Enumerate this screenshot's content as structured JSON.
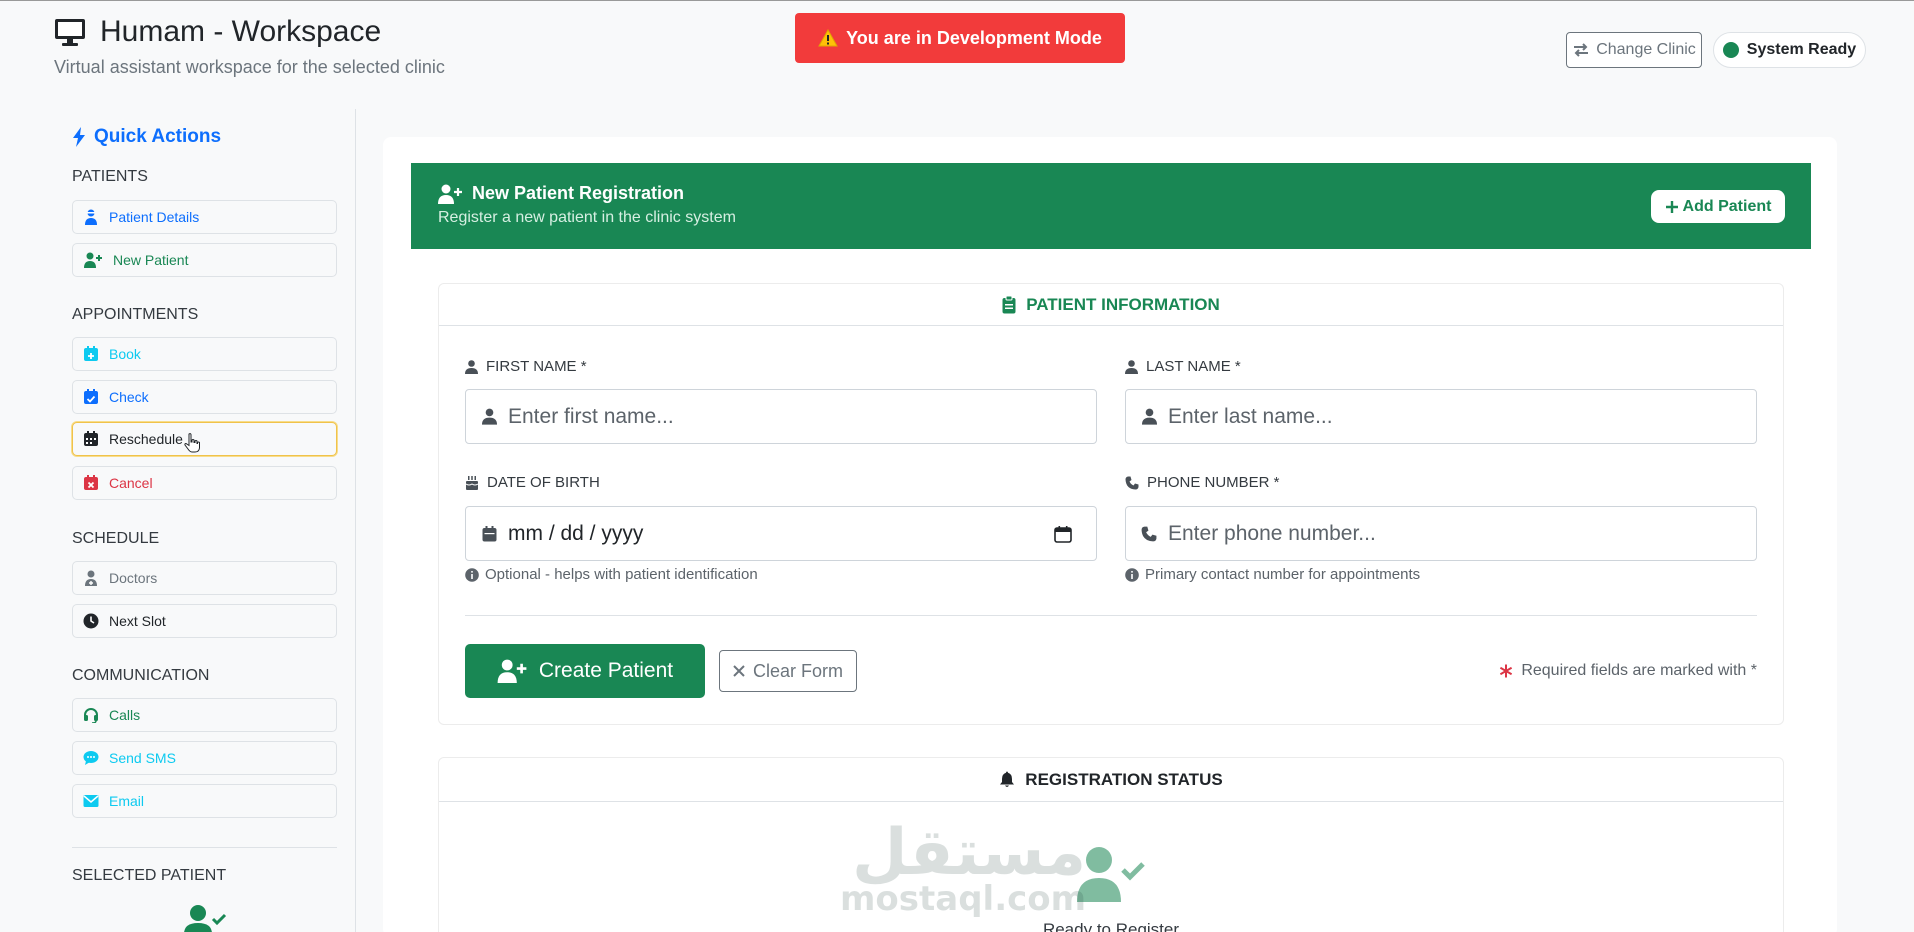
{
  "header": {
    "title": "Humam - Workspace",
    "subtitle": "Virtual assistant workspace for the selected clinic",
    "dev_banner": "You are in Development Mode",
    "change_clinic_label": "Change Clinic",
    "system_status": "System Ready"
  },
  "sidebar": {
    "title": "Quick Actions",
    "sections": {
      "patients": "PATIENTS",
      "appointments": "APPOINTMENTS",
      "schedule": "SCHEDULE",
      "communication": "COMMUNICATION",
      "selected_patient": "SELECTED PATIENT"
    },
    "items": {
      "patient_details": "Patient Details",
      "new_patient": "New Patient",
      "book": "Book",
      "check": "Check",
      "reschedule": "Reschedule",
      "cancel": "Cancel",
      "doctors": "Doctors",
      "next_slot": "Next Slot",
      "calls": "Calls",
      "send_sms": "Send SMS",
      "email": "Email"
    }
  },
  "registration": {
    "title": "New Patient Registration",
    "subtitle": "Register a new patient in the clinic system",
    "add_patient_label": "Add Patient"
  },
  "form": {
    "title": "PATIENT INFORMATION",
    "first_name": {
      "label": "FIRST NAME *",
      "placeholder": "Enter first name..."
    },
    "last_name": {
      "label": "LAST NAME *",
      "placeholder": "Enter last name..."
    },
    "dob": {
      "label": "DATE OF BIRTH",
      "value": "mm / dd / yyyy",
      "help": "Optional - helps with patient identification"
    },
    "phone": {
      "label": "PHONE NUMBER *",
      "placeholder": "Enter phone number...",
      "help": "Primary contact number for appointments"
    },
    "create_label": "Create Patient",
    "clear_label": "Clear Form",
    "required_note": "Required fields are marked with *"
  },
  "status": {
    "title": "REGISTRATION STATUS",
    "ready_text": "Ready to Register"
  },
  "watermark": {
    "arabic": "مستقل",
    "latin": "mostaql.com"
  },
  "colors": {
    "primary": "#0d6efd",
    "success": "#198754",
    "danger": "#f23b3b",
    "info": "#0dcaf0",
    "warning_border": "#f0c24a"
  }
}
